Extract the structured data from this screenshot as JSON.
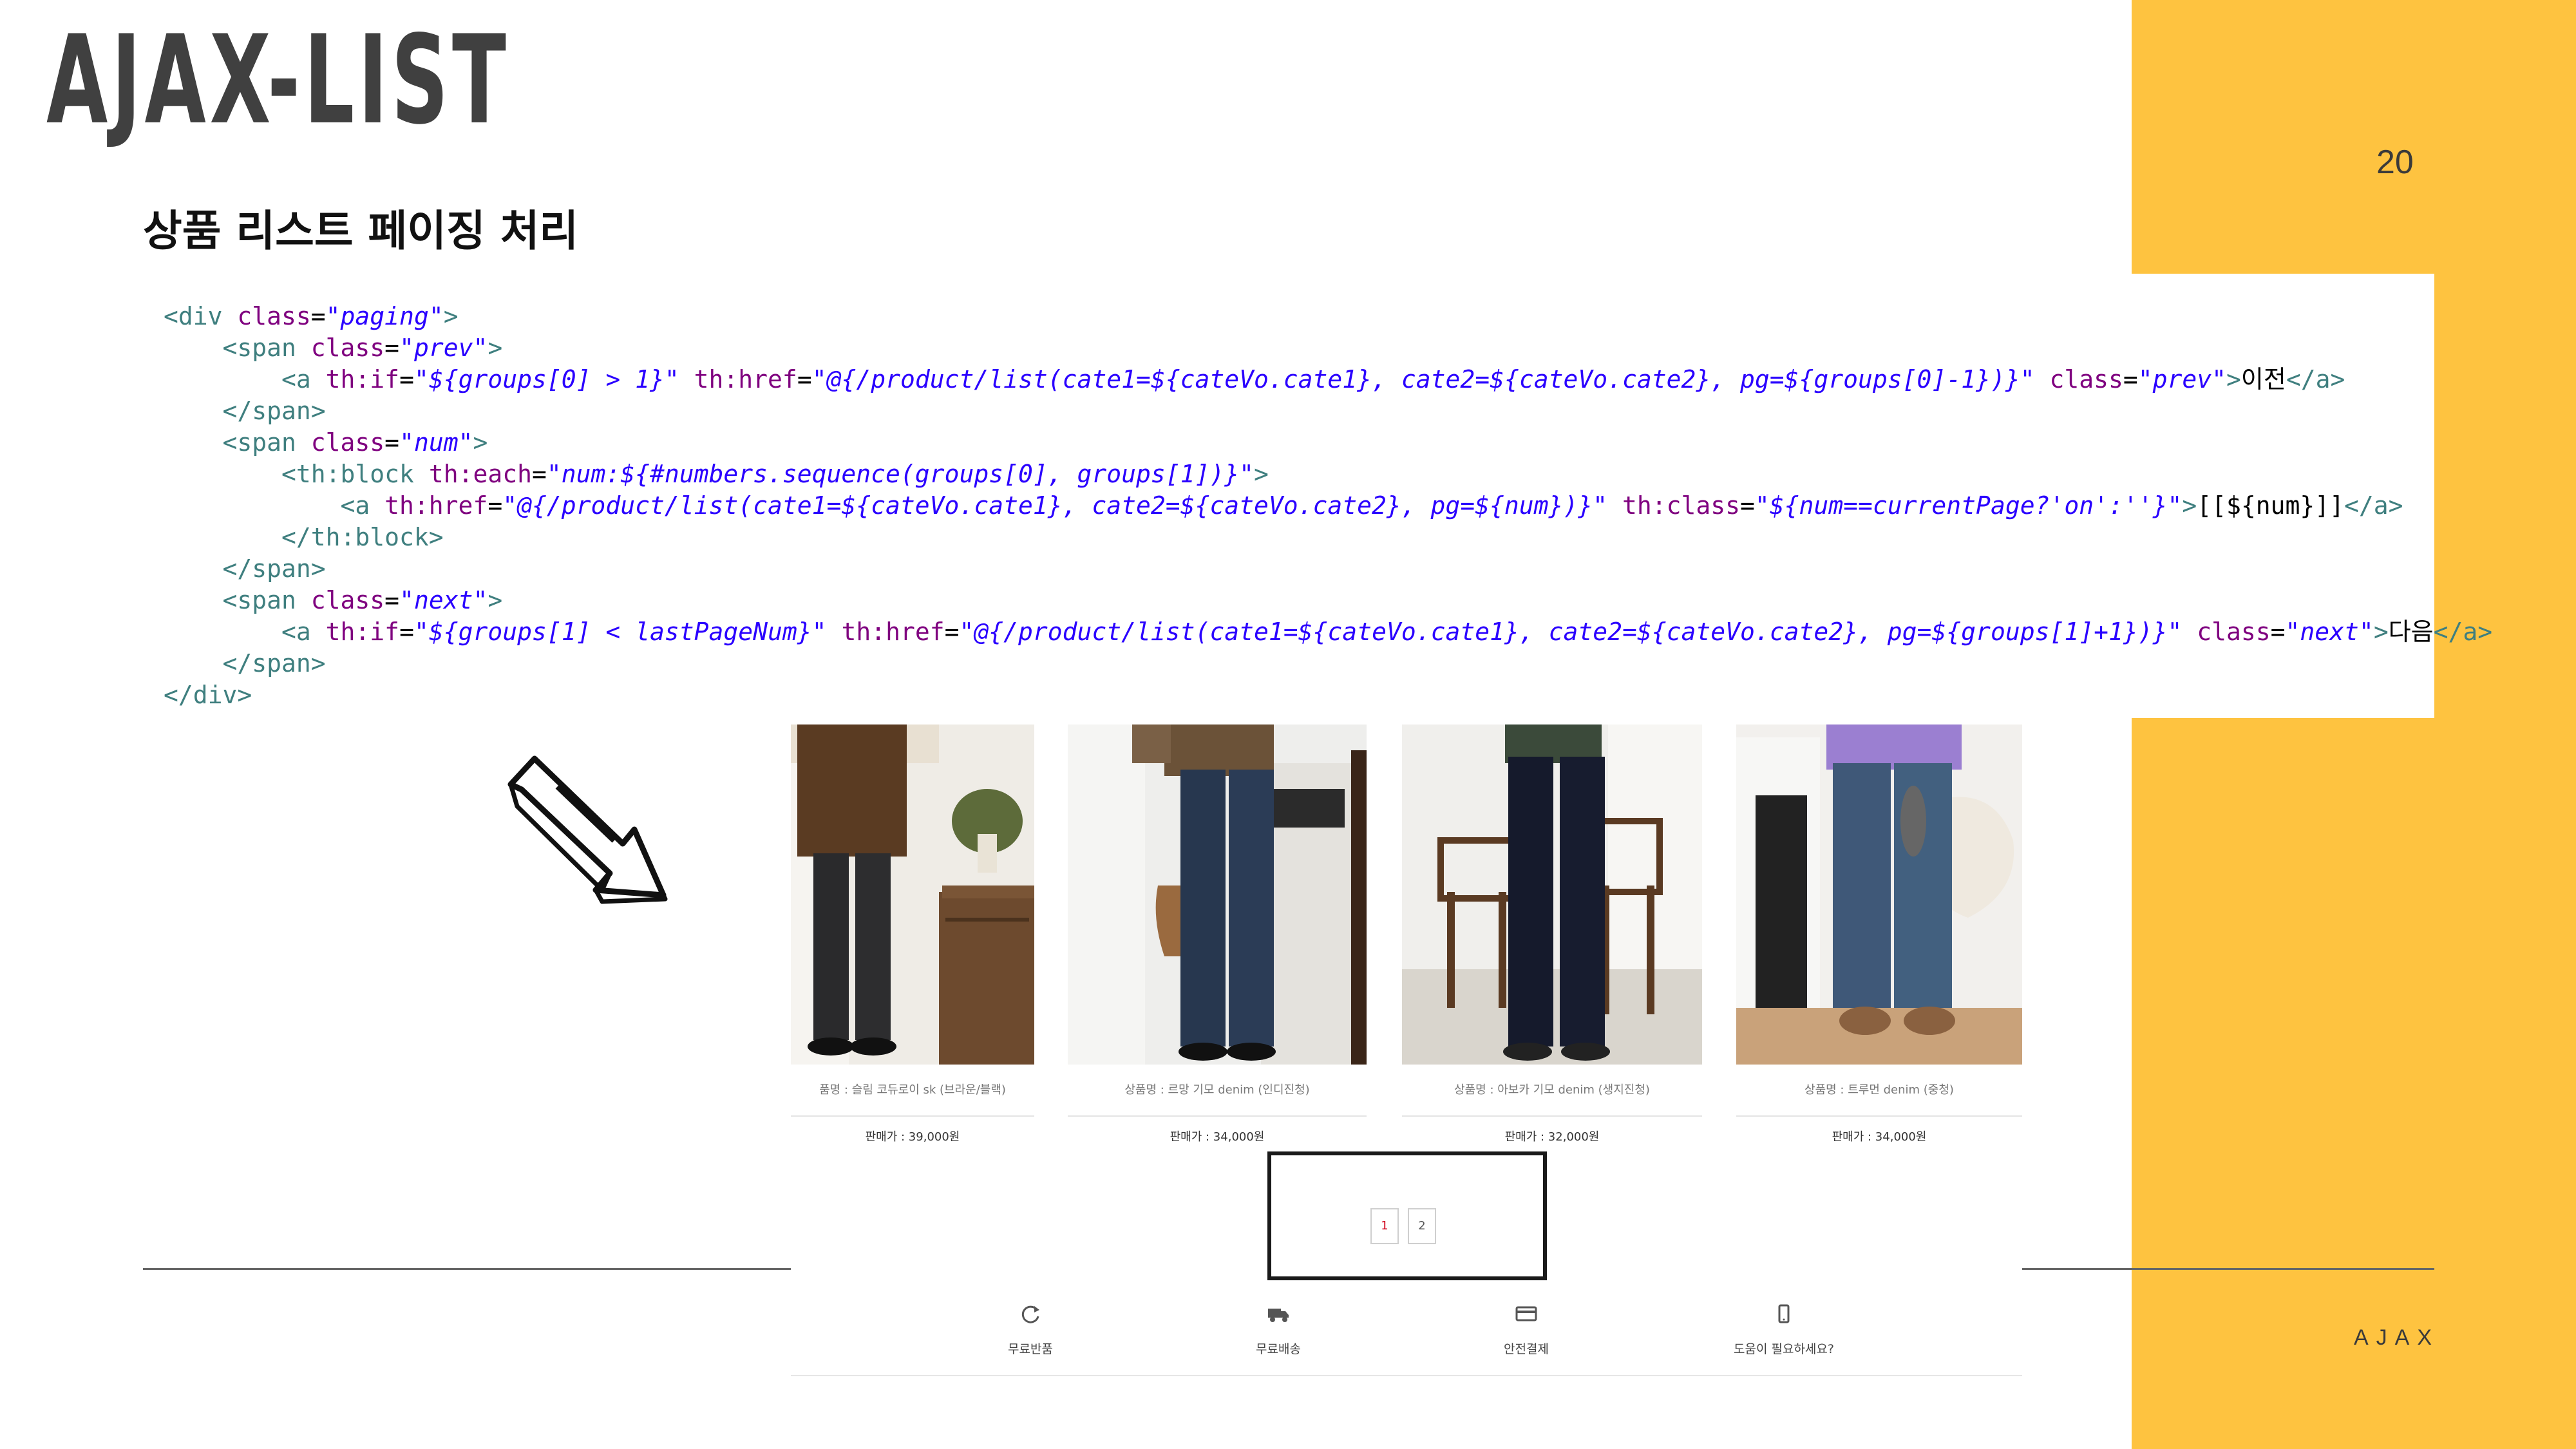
{
  "slide": {
    "title": "AJAX-LIST",
    "section_title": "상품 리스트 페이징 처리",
    "page_number": "20",
    "footer_label": "AJAX",
    "colors": {
      "accent": "#fec340",
      "title": "#404040"
    }
  },
  "code": {
    "language": "html-thymeleaf",
    "lines": {
      "l1": {
        "a": "<div ",
        "b": "class",
        "c": "=",
        "d": "\"paging\"",
        "e": ">"
      },
      "l2": {
        "a": "    <span ",
        "b": "class",
        "c": "=",
        "d": "\"prev\"",
        "e": ">"
      },
      "l3": {
        "a": "        <a ",
        "b": "th:if",
        "c": "=",
        "d": "\"${groups[0] > 1}\"",
        "e": " ",
        "f": "th:href",
        "g": "=",
        "h": "\"@{/product/list(cate1=${cateVo.cate1}, cate2=${cateVo.cate2}, pg=${groups[0]-1})}\"",
        "i": " ",
        "j": "class",
        "k": "=",
        "l": "\"prev\"",
        "m": ">",
        "n": "이전",
        "o": "</a>"
      },
      "l4": {
        "a": "    </span>"
      },
      "l5": {
        "a": "    <span ",
        "b": "class",
        "c": "=",
        "d": "\"num\"",
        "e": ">"
      },
      "l6": {
        "a": "        <th:block ",
        "b": "th:each",
        "c": "=",
        "d": "\"num:${#numbers.sequence(groups[0], groups[1])}\"",
        "e": ">"
      },
      "l7": {
        "a": "            <a ",
        "b": "th:href",
        "c": "=",
        "d": "\"@{/product/list(cate1=${cateVo.cate1}, cate2=${cateVo.cate2}, pg=${num})}\"",
        "e": " ",
        "f": "th:class",
        "g": "=",
        "h": "\"${num==currentPage?'on':''}\"",
        "i": ">",
        "j": "[[${num}]]",
        "k": "</a>"
      },
      "l8": {
        "a": "        </th:block>"
      },
      "l9": {
        "a": "    </span>"
      },
      "l10": {
        "a": "    <span ",
        "b": "class",
        "c": "=",
        "d": "\"next\"",
        "e": ">"
      },
      "l11": {
        "a": "        <a ",
        "b": "th:if",
        "c": "=",
        "d": "\"${groups[1] < lastPageNum}\"",
        "e": " ",
        "f": "th:href",
        "g": "=",
        "h": "\"@{/product/list(cate1=${cateVo.cate1}, cate2=${cateVo.cate2}, pg=${groups[1]+1})}\"",
        "i": " ",
        "j": "class",
        "k": "=",
        "l": "\"next\"",
        "m": ">",
        "n": "다음",
        "o": "</a>"
      },
      "l12": {
        "a": "    </span>"
      },
      "l13": {
        "a": "</div>"
      }
    }
  },
  "shop": {
    "products": [
      {
        "caption": "품명 : 슬림 코듀로이 sk (브라운/블랙)",
        "price": "판매가 : 39,000원"
      },
      {
        "caption": "상품명 : 르망 기모 denim (인디진청)",
        "price": "판매가 : 34,000원"
      },
      {
        "caption": "상품명 : 아보카 기모 denim (생지진청)",
        "price": "판매가 : 32,000원"
      },
      {
        "caption": "상품명 : 트루먼 denim (중청)",
        "price": "판매가 : 34,000원"
      }
    ],
    "pagination": {
      "pages": [
        "1",
        "2"
      ],
      "current": "1"
    },
    "features": [
      {
        "icon": "refresh-icon",
        "label": "무료반품"
      },
      {
        "icon": "delivery-truck-icon",
        "label": "무료배송"
      },
      {
        "icon": "credit-card-icon",
        "label": "안전결제"
      },
      {
        "icon": "mobile-phone-icon",
        "label": "도움이 필요하세요?"
      }
    ]
  }
}
